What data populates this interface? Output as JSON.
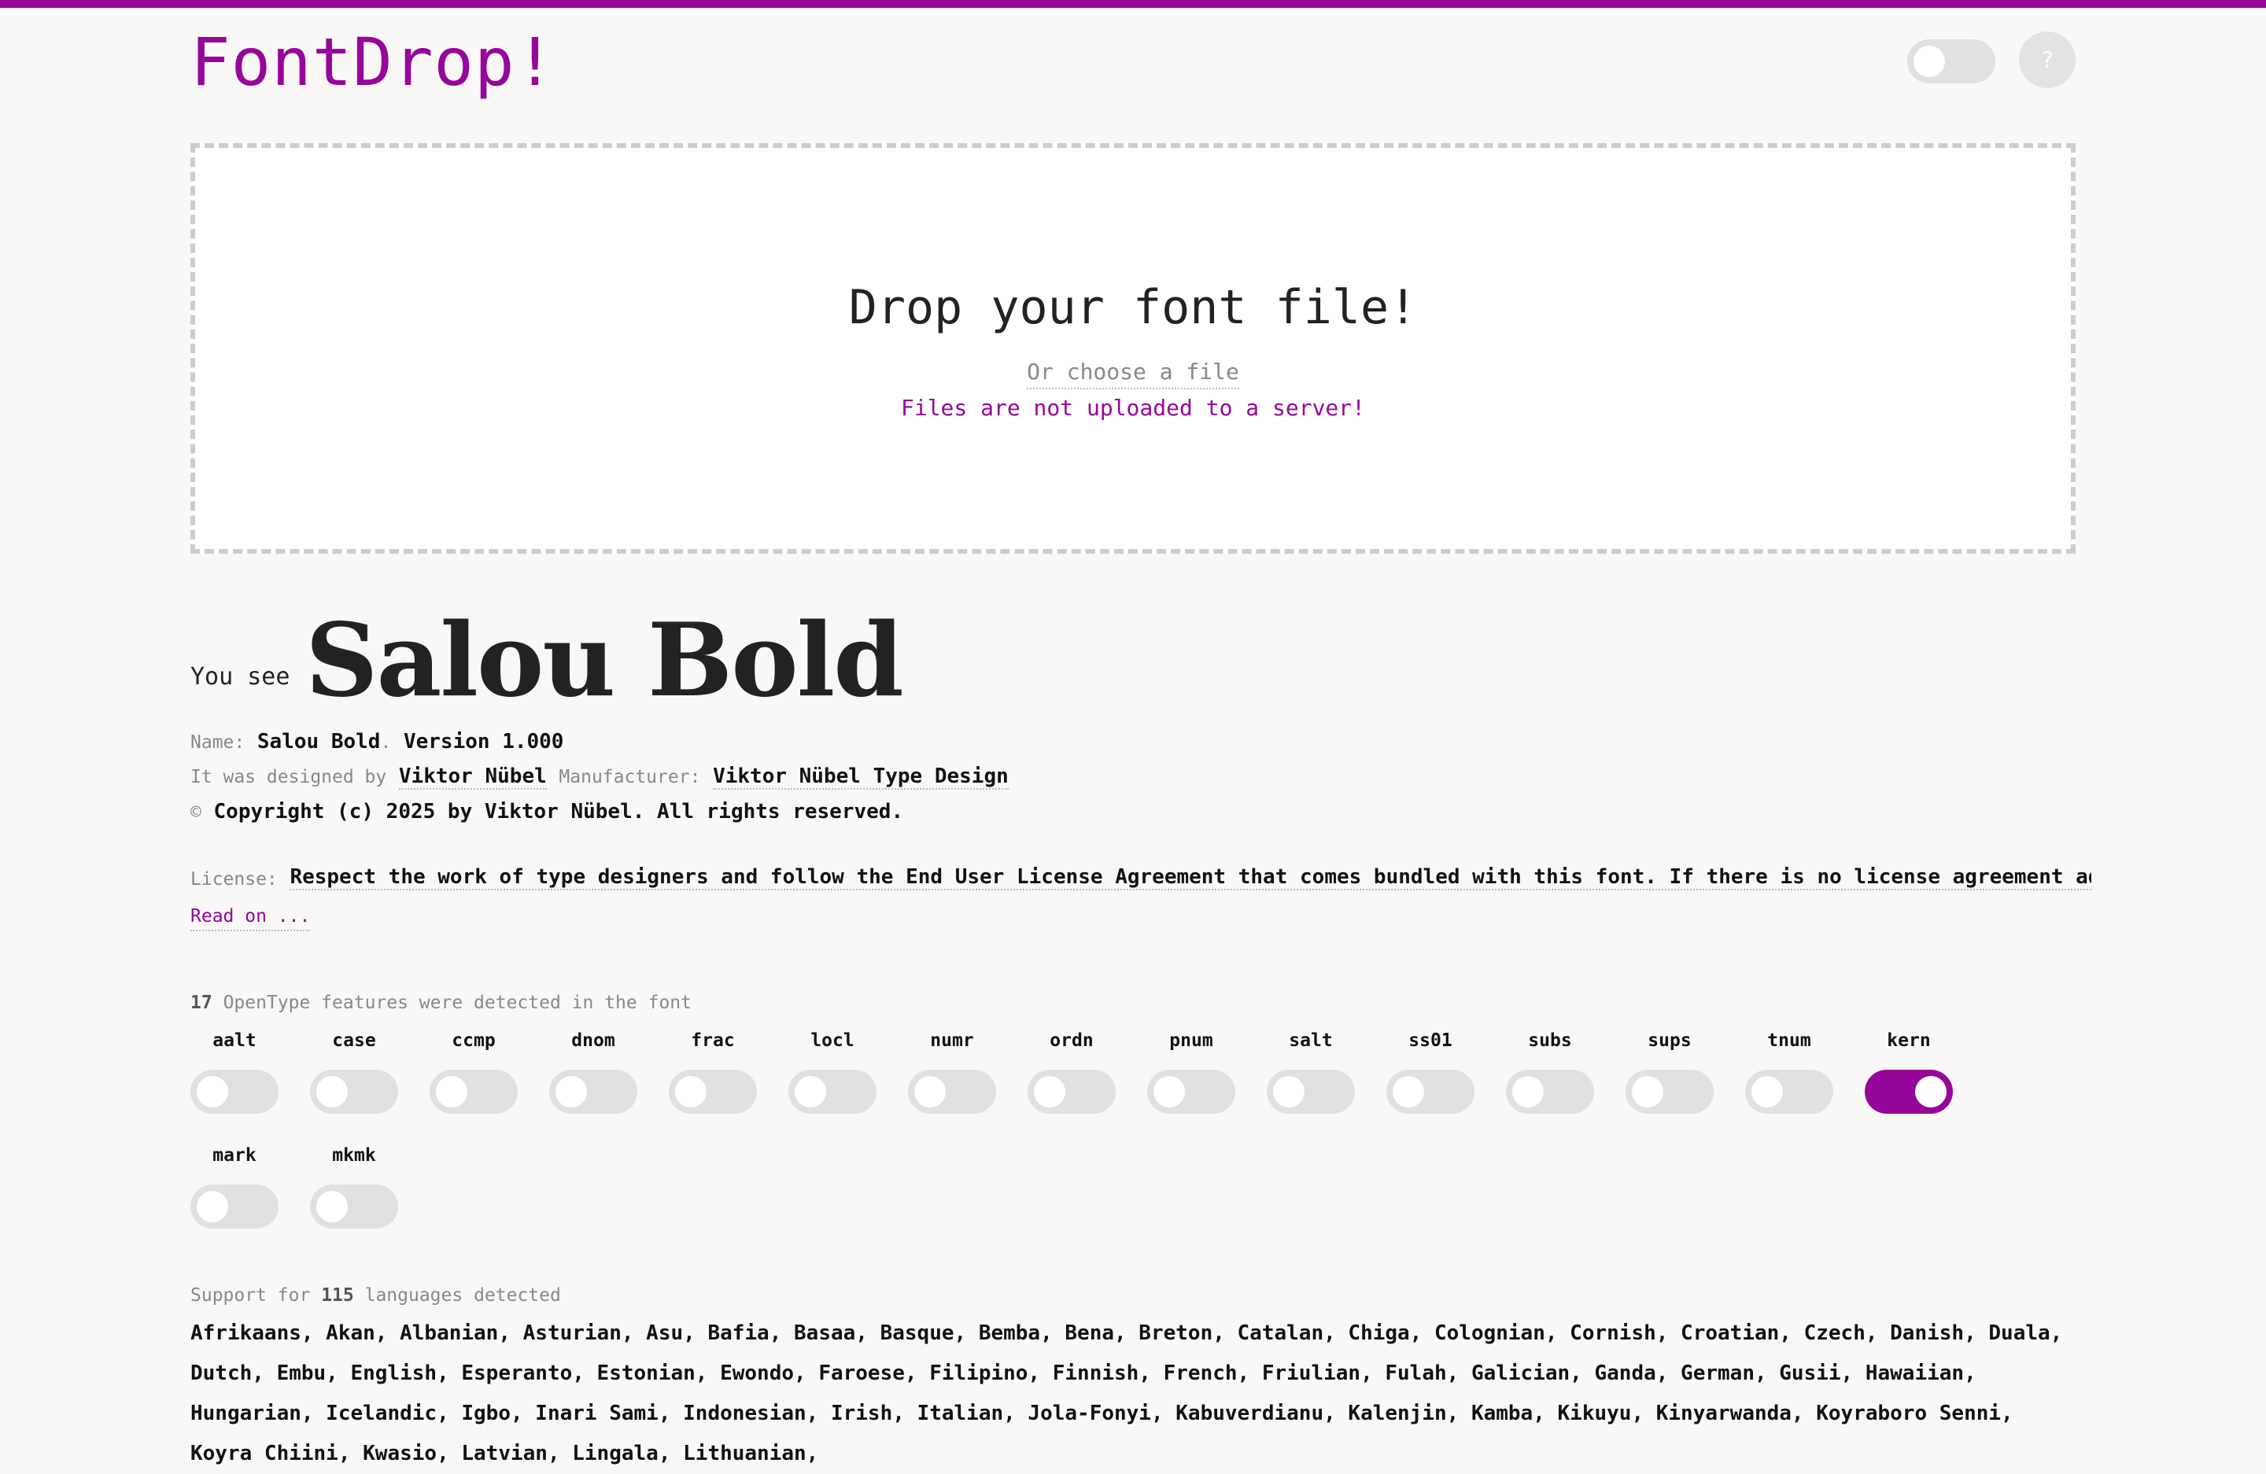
{
  "app": {
    "logo": "FontDrop!",
    "help_label": "?"
  },
  "dropzone": {
    "title": "Drop your font file!",
    "choose": "Or choose a file",
    "note": "Files are not uploaded to a server!"
  },
  "font": {
    "you_see": "You see",
    "display_name": "Salou Bold",
    "name_label": "Name:",
    "name": "Salou Bold",
    "version": "Version 1.000",
    "designed_label": "It was designed by",
    "designer": "Viktor Nübel",
    "manufacturer_label": "Manufacturer:",
    "manufacturer": "Viktor Nübel Type Design",
    "copyright_symbol": "©",
    "copyright": "Copyright (c) 2025 by Viktor Nübel. All rights reserved.",
    "license_label": "License:",
    "license": "Respect the work of type designers and follow the End User License Agreement that comes bundled with this font. If there is no license agreement added or for",
    "read_on": "Read on ..."
  },
  "features": {
    "count": "17",
    "summary": "OpenType features were detected in the font",
    "items": [
      {
        "tag": "aalt",
        "on": false
      },
      {
        "tag": "case",
        "on": false
      },
      {
        "tag": "ccmp",
        "on": false
      },
      {
        "tag": "dnom",
        "on": false
      },
      {
        "tag": "frac",
        "on": false
      },
      {
        "tag": "locl",
        "on": false
      },
      {
        "tag": "numr",
        "on": false
      },
      {
        "tag": "ordn",
        "on": false
      },
      {
        "tag": "pnum",
        "on": false
      },
      {
        "tag": "salt",
        "on": false
      },
      {
        "tag": "ss01",
        "on": false
      },
      {
        "tag": "subs",
        "on": false
      },
      {
        "tag": "sups",
        "on": false
      },
      {
        "tag": "tnum",
        "on": false
      },
      {
        "tag": "kern",
        "on": true
      },
      {
        "tag": "mark",
        "on": false
      },
      {
        "tag": "mkmk",
        "on": false
      }
    ]
  },
  "languages": {
    "prefix": "Support for",
    "count": "115",
    "suffix": "languages detected",
    "list": "Afrikaans, Akan, Albanian, Asturian, Asu, Bafia, Basaa, Basque, Bemba, Bena, Breton, Catalan, Chiga, Colognian, Cornish, Croatian, Czech, Danish, Duala, Dutch, Embu, English, Esperanto, Estonian, Ewondo, Faroese, Filipino, Finnish, French, Friulian, Fulah, Galician, Ganda, German, Gusii, Hawaiian, Hungarian, Icelandic, Igbo, Inari Sami, Indonesian, Irish, Italian, Jola-Fonyi, Kabuverdianu, Kalenjin, Kamba, Kikuyu, Kinyarwanda, Koyraboro Senni, Koyra Chiini, Kwasio, Latvian, Lingala, Lithuanian,"
  },
  "colors": {
    "accent": "#96069b",
    "background": "#f9f8f6",
    "toggle_off": "#e0e0e0"
  },
  "icons": {
    "help": "question-mark-icon"
  }
}
